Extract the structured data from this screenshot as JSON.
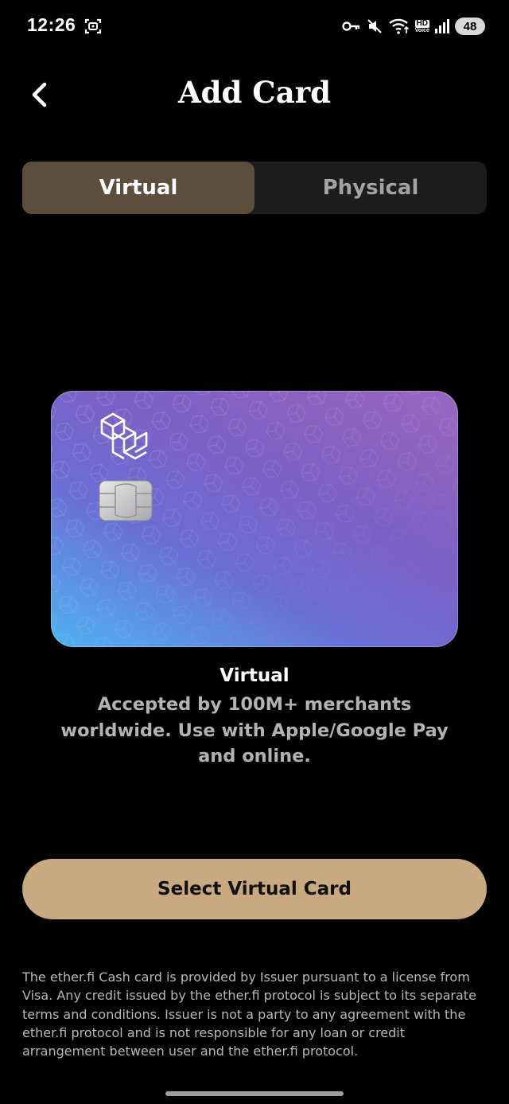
{
  "status_bar": {
    "time": "12:26",
    "hd_label": "HD",
    "voice_label": "Voice",
    "battery": "48",
    "icons": [
      "screen-record-icon",
      "key-icon",
      "mute-icon",
      "wifi-icon",
      "hd-voice-icon",
      "signal-icon",
      "battery-icon"
    ]
  },
  "header": {
    "title": "Add Card",
    "back_icon": "chevron-left-icon"
  },
  "tabs": [
    {
      "label": "Virtual",
      "selected": true
    },
    {
      "label": "Physical",
      "selected": false
    }
  ],
  "card": {
    "gradient_colors": [
      "#4fb3f0",
      "#6a6fd6",
      "#7d5fc4",
      "#9a67c2"
    ],
    "logo_icon": "etherfi-logo-icon",
    "chip_icon": "card-chip-icon"
  },
  "selected_card": {
    "name": "Virtual",
    "description": "Accepted by 100M+ merchants worldwide. Use with Apple/Google Pay and online."
  },
  "actions": {
    "select_label": "Select Virtual Card"
  },
  "disclaimer": "The ether.fi Cash card is provided by Issuer pursuant to a license from Visa. Any credit issued by the ether.fi protocol is subject to its separate terms and conditions. Issuer is not a party to any agreement with the ether.fi protocol and is not responsible for any loan or credit arrangement between user and the ether.fi protocol.",
  "colors": {
    "background": "#000000",
    "tab_active": "#5c4d3d",
    "tab_track": "#1c1c1c",
    "button": "#c9a97f",
    "muted_text": "#b3b3b3"
  }
}
